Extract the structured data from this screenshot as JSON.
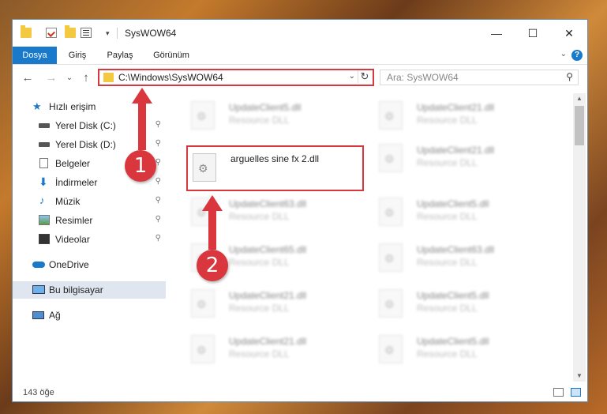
{
  "window": {
    "title": "SysWOW64",
    "minimize_glyph": "—",
    "maximize_glyph": "☐",
    "close_glyph": "✕"
  },
  "ribbon": {
    "tabs": [
      {
        "label": "Dosya",
        "active": true
      },
      {
        "label": "Giriş",
        "active": false
      },
      {
        "label": "Paylaş",
        "active": false
      },
      {
        "label": "Görünüm",
        "active": false
      }
    ],
    "collapse_glyph": "⌄",
    "help_glyph": "?"
  },
  "nav": {
    "back_glyph": "←",
    "forward_glyph": "→",
    "recent_glyph": "⌄",
    "up_glyph": "↑"
  },
  "address": {
    "path": "C:\\Windows\\SysWOW64",
    "dropdown_glyph": "⌄",
    "refresh_glyph": "↻"
  },
  "search": {
    "placeholder": "Ara: SysWOW64",
    "icon_glyph": "⚲"
  },
  "sidebar": {
    "items": [
      {
        "label": "Hızlı erişim",
        "icon": "star-icon",
        "pinned": false
      },
      {
        "label": "Yerel Disk (C:)",
        "icon": "drive-icon",
        "pinned": true
      },
      {
        "label": "Yerel Disk (D:)",
        "icon": "drive-icon",
        "pinned": true
      },
      {
        "label": "Belgeler",
        "icon": "documents-icon",
        "pinned": true
      },
      {
        "label": "İndirmeler",
        "icon": "download-icon",
        "pinned": true
      },
      {
        "label": "Müzik",
        "icon": "music-icon",
        "pinned": true
      },
      {
        "label": "Resimler",
        "icon": "pictures-icon",
        "pinned": true
      },
      {
        "label": "Videolar",
        "icon": "videos-icon",
        "pinned": true
      },
      {
        "label": "OneDrive",
        "icon": "cloud-icon",
        "pinned": false
      },
      {
        "label": "Bu bilgisayar",
        "icon": "computer-icon",
        "pinned": false,
        "selected": true
      },
      {
        "label": "Ağ",
        "icon": "network-icon",
        "pinned": false
      }
    ],
    "pin_glyph": "📌"
  },
  "files": [
    {
      "name": "UpdateClient5.dll",
      "type": "Resource DLL",
      "blurred": true
    },
    {
      "name": "UpdateClient21.dll",
      "type": "Resource DLL",
      "blurred": true
    },
    {
      "name": "arguelles sine fx 2.dll",
      "type": "",
      "blurred": false,
      "highlighted": true
    },
    {
      "name": "UpdateClient21.dll",
      "type": "Resource DLL",
      "blurred": true
    },
    {
      "name": "UpdateClient63.dll",
      "type": "Resource DLL",
      "blurred": true
    },
    {
      "name": "UpdateClient5.dll",
      "type": "Resource DLL",
      "blurred": true
    },
    {
      "name": "UpdateClient65.dll",
      "type": "Resource DLL",
      "blurred": true
    },
    {
      "name": "UpdateClient63.dll",
      "type": "Resource DLL",
      "blurred": true
    },
    {
      "name": "UpdateClient21.dll",
      "type": "Resource DLL",
      "blurred": true
    },
    {
      "name": "UpdateClient5.dll",
      "type": "Resource DLL",
      "blurred": true
    },
    {
      "name": "UpdateClient21.dll",
      "type": "Resource DLL",
      "blurred": true
    },
    {
      "name": "UpdateClient5.dll",
      "type": "Resource DLL",
      "blurred": true
    }
  ],
  "status": {
    "item_count": "143 öğe"
  },
  "annotations": {
    "step1": "1",
    "step2": "2",
    "color": "#d9363e"
  },
  "colors": {
    "accent": "#1979ca",
    "highlight": "#d9363e",
    "folder": "#f5c842"
  }
}
